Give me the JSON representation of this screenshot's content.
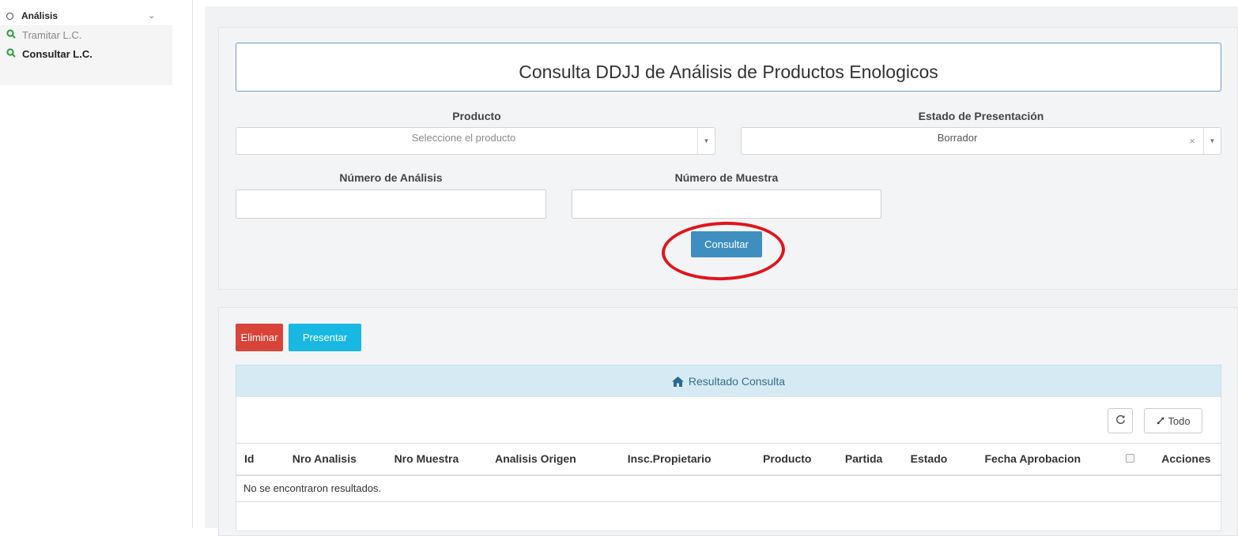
{
  "sidebar": {
    "section": "Análisis",
    "items": [
      {
        "label": "Tramitar L.C."
      },
      {
        "label": "Consultar L.C."
      }
    ]
  },
  "form": {
    "title": "Consulta DDJJ de Análisis de Productos Enologicos",
    "producto_label": "Producto",
    "producto_placeholder": "Seleccione el producto",
    "estado_label": "Estado de Presentación",
    "estado_value": "Borrador",
    "nro_analisis_label": "Número de Análisis",
    "nro_muestra_label": "Número de Muestra",
    "consultar_label": "Consultar"
  },
  "results": {
    "eliminar_label": "Eliminar",
    "presentar_label": "Presentar",
    "header": "Resultado Consulta",
    "todo_label": "Todo",
    "columns": [
      "Id",
      "Nro Analisis",
      "Nro Muestra",
      "Analisis Origen",
      "Insc.Propietario",
      "Producto",
      "Partida",
      "Estado",
      "Fecha Aprobacion",
      "",
      "Acciones"
    ],
    "empty_message": "No se encontraron resultados."
  },
  "colors": {
    "accent": "#3e8ebf",
    "danger": "#d9443a",
    "info": "#18b8e2",
    "highlight": "#e2141b"
  }
}
